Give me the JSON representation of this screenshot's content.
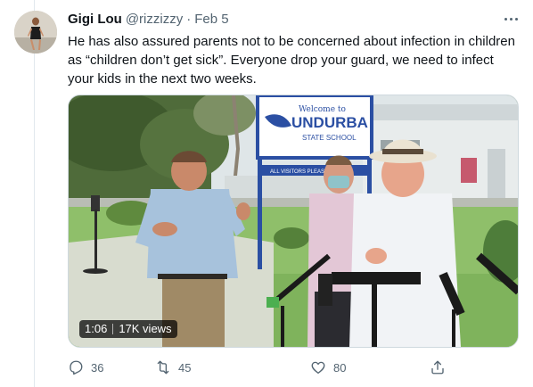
{
  "tweet": {
    "author_name": "Gigi Lou",
    "handle": "@rizzizzy",
    "separator": "·",
    "date": "Feb 5",
    "text": "He has also assured parents not to be concerned about infection in children as “children don’t get sick”. Everyone drop your guard, we need to infect your kids in the next two weeks.",
    "avatar_icon": "person-avatar",
    "more_icon": "more-options-icon"
  },
  "media": {
    "type": "video",
    "sign_top": "Welcome to",
    "sign_main": "UNDURBA",
    "sign_sub": "STATE SCHOOL",
    "sign_banner": "ALL VISITORS PLEASE SIGN",
    "duration": "1:06",
    "views": "17K views"
  },
  "actions": {
    "reply": {
      "icon": "reply-icon",
      "count": "36"
    },
    "retweet": {
      "icon": "retweet-icon",
      "count": "45"
    },
    "like": {
      "icon": "like-icon",
      "count": "80"
    },
    "share": {
      "icon": "share-icon"
    }
  },
  "colors": {
    "text_primary": "#0f1419",
    "text_secondary": "#536471",
    "border": "#cfd9de",
    "sign_blue": "#2b4fa3"
  }
}
